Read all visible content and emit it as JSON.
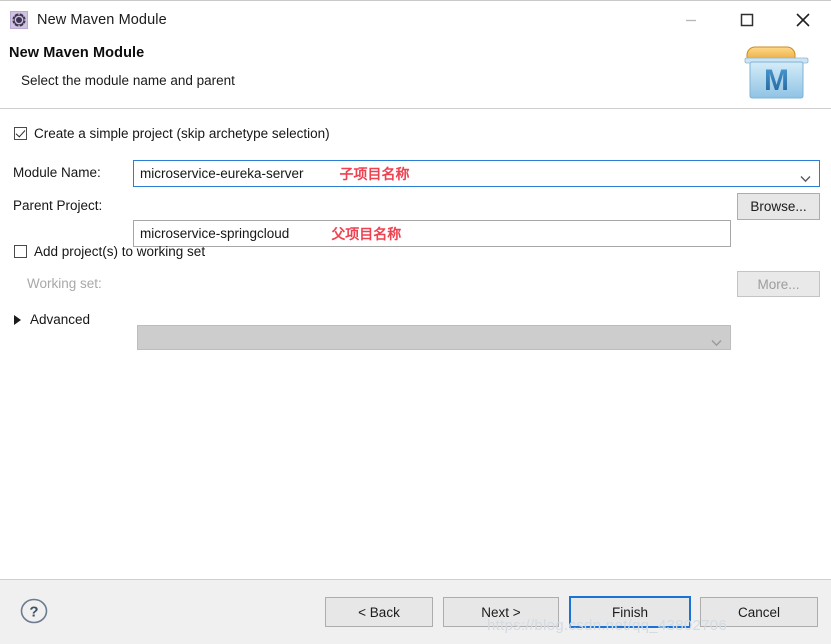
{
  "window": {
    "title": "New Maven Module",
    "icon": "maven-module-icon",
    "controls": {
      "minimize": "minimize-icon",
      "maximize": "maximize-icon",
      "close": "close-icon"
    }
  },
  "header": {
    "title": "New Maven Module",
    "subtitle": "Select the module name and parent",
    "logo": "maven-folder-logo"
  },
  "form": {
    "simple_project": {
      "label": "Create a simple project (skip archetype selection)",
      "checked": true
    },
    "module_name": {
      "label": "Module Name:",
      "value": "microservice-eureka-server",
      "annotation": "子项目名称",
      "focused": true
    },
    "parent_project": {
      "label": "Parent Project:",
      "value": "microservice-springcloud",
      "annotation": "父项目名称",
      "browse_label": "Browse..."
    },
    "add_to_working_set": {
      "label": "Add project(s) to working set",
      "checked": false
    },
    "working_set": {
      "label": "Working set:",
      "value": "",
      "more_label": "More...",
      "disabled": true
    },
    "advanced": {
      "label": "Advanced",
      "expanded": false
    }
  },
  "footer": {
    "help": "help-icon",
    "buttons": {
      "back": "< Back",
      "next": "Next >",
      "finish": "Finish",
      "cancel": "Cancel"
    },
    "watermark": "https://blog.csdn.net/qq_43802706"
  },
  "colors": {
    "accent": "#1b74d4",
    "annotation": "#ef4150",
    "field_border": "#a7a7a7",
    "footer_bg": "#f0f0f0"
  }
}
